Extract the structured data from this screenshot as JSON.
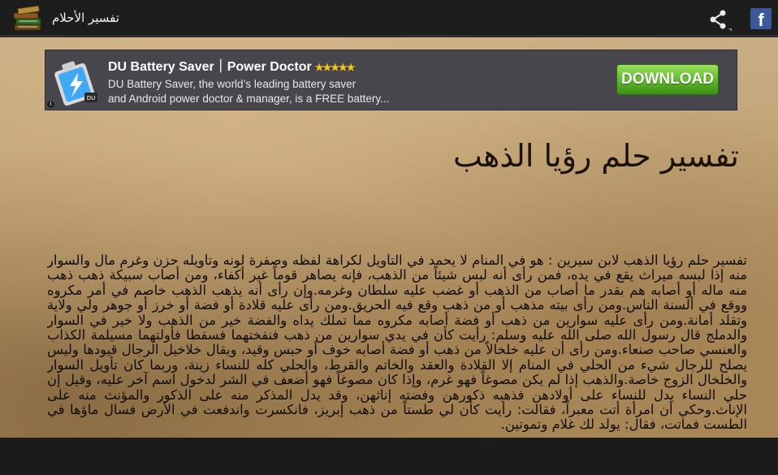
{
  "app": {
    "title": "تفسير الأحلام",
    "icon": "books-icon"
  },
  "actions": {
    "share_icon": "share-icon",
    "facebook_icon": "facebook-icon",
    "facebook_letter": "f"
  },
  "ad": {
    "title": "DU Battery Saver｜Power Doctor",
    "stars": "★★★★★",
    "rating": 4.5,
    "description_line1": "DU Battery Saver, the world’s leading battery saver",
    "description_line2": "and Android power doctor & manager, is a FREE battery...",
    "cta": "DOWNLOAD",
    "info_badge": "i",
    "colors": {
      "banner": "#46464c",
      "cta": "#5db52a"
    }
  },
  "article": {
    "title": "تفسير حلم رؤيا الذهب",
    "body": "تفسير حلم رؤيا الذهب لابن سيرين : هو في المنام لا يحمد في التأويل لكراهة لفظه وصفرة لونه وتأويله حزن وغرم مال والسوار منه إذا لبسه ميراث يقع في يده، فمن رأى أنه لبس شيئاً من الذهب، فإنه يصاهر قوماً غير أكفاء، ومن أصاب سبيكة ذهب ذهب منه ماله أو أصابه هم بقدر ما أصاب من الذهب أو غضب عليه سلطان وغرمه.وإن رأى أنه يذهب الذهب خاصم في أمر مكروه ووقع في ألسنة الناس.ومن رأى بيته مذهب أو من ذهب وقع فيه الحريق.ومن رأى عليه قلادة أو فضة أو خرز أو جوهر ولي ولاية وتقلد أمانة.ومن رأى عليه سوارين من ذهب أو فضة أصابه مكروه مما تملك يداه والفضة خير من الذهب ولا خير في السوار والدملج قال رسول الله صلى الله عليه وسلم: رأيت كأن في يدي سوارين من ذهب فنفختهما فسقطا فأولتهما مسيلمة الكذاب والعنسي صاحب صنعاء.ومن رأى أن عليه خلخالاً من ذهب أو فضة أصابه خوف أو حبس وقيد، ويقال خلاخيل الرجال قيودها وليس يصلح للرجال شيء من الحلي في المنام إلا القلادة والعقد والخاتم والقرط، والحلي كله للنساء زينة، وربما كان تأويل السوار والخلخال الزوج خاصة.والذهب إذا لم يكن مصوغاً فهو غرم، وإذا كان مصوغاً فهو أضعف في الشر لدخول اسم آخر عليه، وقيل إن حلي النساء يدل للنساء على أولادهن فذهبه ذكورهن وفضته إناثهن، وقد يدل المذكر منه على الذكور والمؤنث منه على الإناث.وحكي أن امرأة أتت معبراً، فقالت: رأيت كأن لي طستاً من ذهب إبريز، فانكسرت واندفعت في الأرض فسال ماؤها في الطست فماتت، فقال: يولد لك غلام وتموتين."
  }
}
